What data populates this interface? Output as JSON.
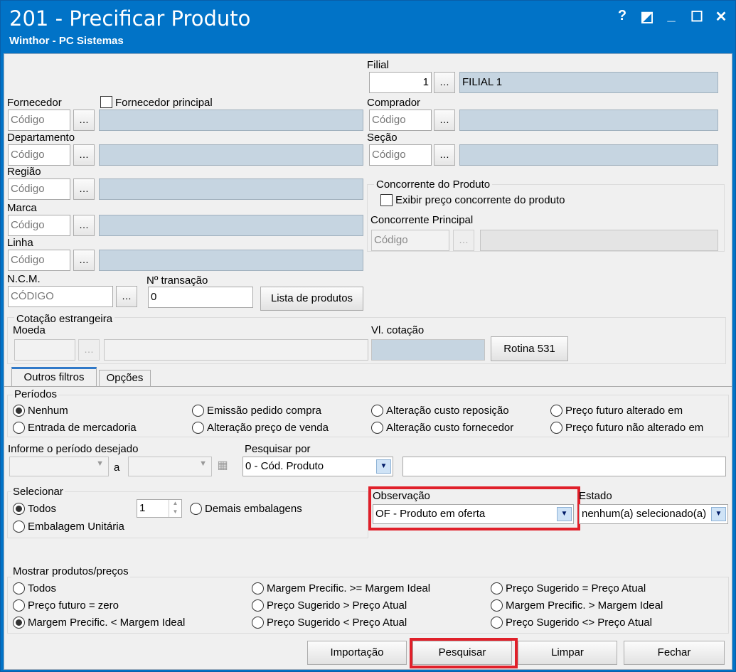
{
  "window": {
    "title": "201 - Precificar Produto",
    "subtitle": "Winthor - PC Sistemas",
    "controls": [
      "?",
      "◩",
      "_",
      "☐",
      "✕"
    ]
  },
  "filial": {
    "label": "Filial",
    "code": "1",
    "name": "FILIAL 1"
  },
  "fornecedor": {
    "label": "Fornecedor",
    "placeholder": "Código",
    "principal_label": "Fornecedor principal"
  },
  "comprador": {
    "label": "Comprador",
    "placeholder": "Código"
  },
  "departamento": {
    "label": "Departamento",
    "placeholder": "Código"
  },
  "secao": {
    "label": "Seção",
    "placeholder": "Código"
  },
  "regiao": {
    "label": "Região",
    "placeholder": "Código"
  },
  "concorrente": {
    "group_label": "Concorrente do Produto",
    "exibir_label": "Exibir preço concorrente do produto",
    "principal_label": "Concorrente Principal",
    "placeholder": "Código"
  },
  "marca": {
    "label": "Marca",
    "placeholder": "Código"
  },
  "linha": {
    "label": "Linha",
    "placeholder": "Código"
  },
  "ncm": {
    "label": "N.C.M.",
    "placeholder": "CÓDIGO"
  },
  "transacao": {
    "label": "Nº transação",
    "value": "0"
  },
  "lista_produtos_button": "Lista de produtos",
  "cotacao": {
    "group_label": "Cotação estrangeira",
    "moeda_label": "Moeda",
    "vl_label": "Vl. cotação",
    "rotina_button": "Rotina 531"
  },
  "tabs": [
    {
      "label": "Outros filtros",
      "active": true
    },
    {
      "label": "Opções",
      "active": false
    }
  ],
  "periodos": {
    "label": "Períodos",
    "options": [
      "Nenhum",
      "Emissão pedido compra",
      "Alteração custo reposição",
      "Preço futuro alterado em",
      "Entrada de mercadoria",
      "Alteração preço de venda",
      "Alteração custo fornecedor",
      "Preço futuro não alterado em"
    ],
    "selected": "Nenhum"
  },
  "periodo_desejado": {
    "label": "Informe o período desejado",
    "separator": "a"
  },
  "pesquisar_por": {
    "label": "Pesquisar por",
    "value": "0 - Cód. Produto",
    "search_value": ""
  },
  "selecionar": {
    "label": "Selecionar",
    "todos": "Todos",
    "unitaria": "Embalagem Unitária",
    "qty": "1",
    "demais": "Demais embalagens",
    "selected": "Todos"
  },
  "observacao": {
    "label": "Observação",
    "value": "OF - Produto em oferta"
  },
  "estado": {
    "label": "Estado",
    "value": "nenhum(a) selecionado(a)"
  },
  "mostrar": {
    "label": "Mostrar produtos/preços",
    "options": [
      "Todos",
      "Margem Precific. >= Margem Ideal",
      "Preço Sugerido = Preço Atual",
      "Preço futuro = zero",
      "Preço Sugerido > Preço Atual",
      "Margem Precific. > Margem Ideal",
      "Margem Precific. < Margem Ideal",
      "Preço Sugerido < Preço Atual",
      "Preço Sugerido <> Preço Atual"
    ],
    "selected": "Margem Precific. < Margem Ideal"
  },
  "buttons": {
    "importacao": "Importação",
    "pesquisar": "Pesquisar",
    "limpar": "Limpar",
    "fechar": "Fechar"
  },
  "colors": {
    "title_bar": "#0173c7",
    "highlight": "#e0202a",
    "readonly_field": "#c6d5e1"
  }
}
